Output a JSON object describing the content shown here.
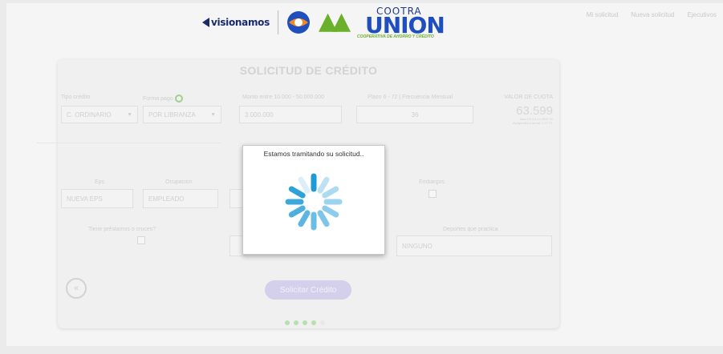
{
  "header": {
    "visionamos_label": "visionamos",
    "cootra_label": "COOTRA",
    "union_label": "UNION",
    "coop_label": "COOPERATIVA DE AHORRO Y CRÉDITO",
    "links": [
      "Mi solicitud",
      "Nueva solicitud",
      "Ejecutivos"
    ]
  },
  "form": {
    "title": "SOLICITUD DE CRÉDITO",
    "tipo_credito": {
      "label": "Tipo crédito",
      "value": "C. ORDINARIO"
    },
    "forma_pago": {
      "label": "Forma pago",
      "value": "POR LIBRANZA"
    },
    "monto": {
      "label": "Monto entre 10.000 - 50.000.000",
      "value": "3.000.000"
    },
    "plazo": {
      "label": "Plazo 6 - 72 | Frecuencia Mensual",
      "value": "36"
    },
    "cuota": {
      "label": "VALOR DE CUOTA",
      "value": "63.599",
      "note_line1": "Tasa 1% EA 12.68% Sv",
      "note_line2": "Aseguradora anual: 1.77 YT"
    },
    "eps": {
      "label": "Eps",
      "value": "NUEVA EPS"
    },
    "ocupacion": {
      "label": "Ocupación",
      "value": "EMPLEADO"
    },
    "embargo": {
      "label": "Embargos"
    },
    "prestamos": {
      "label": "Tiene préstamos o cruces?"
    },
    "deportes": {
      "label": "Deportes que practica",
      "value": "NINGUNO"
    },
    "submit_label": "Solicitar Crédito",
    "back_icon": "«"
  },
  "modal": {
    "message": "Estamos tramitando su solicitud.."
  },
  "progress": {
    "current_step": 4,
    "total_steps": 5
  },
  "colors": {
    "spinner": "#1e9ad6",
    "submit_bg": "#d4cfeb",
    "step_dot": "#b6e0ad"
  }
}
